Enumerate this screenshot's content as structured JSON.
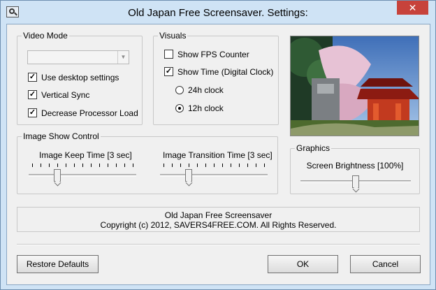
{
  "window": {
    "title": "Old Japan Free Screensaver. Settings:",
    "close_glyph": "✕"
  },
  "video_mode": {
    "legend": "Video Mode",
    "resolution_value": "",
    "options": [
      {
        "label": "Use desktop settings",
        "checked": true
      },
      {
        "label": "Vertical Sync",
        "checked": true
      },
      {
        "label": "Decrease Processor Load",
        "checked": true
      }
    ]
  },
  "visuals": {
    "legend": "Visuals",
    "show_fps": {
      "label": "Show FPS Counter",
      "checked": false
    },
    "show_time": {
      "label": "Show Time (Digital Clock)",
      "checked": true
    },
    "clock_24h": {
      "label": "24h clock",
      "selected": false
    },
    "clock_12h": {
      "label": "12h clock",
      "selected": true
    }
  },
  "image_show": {
    "legend": "Image Show Control",
    "keep_time_label": "Image Keep Time [3 sec]",
    "keep_time_fraction": 0.25,
    "transition_label": "Image Transition Time [3 sec]",
    "transition_fraction": 0.25
  },
  "graphics": {
    "legend": "Graphics",
    "brightness_label": "Screen Brightness [100%]",
    "brightness_fraction": 0.5
  },
  "info": {
    "line1": "Old Japan Free Screensaver",
    "line2": "Copyright (c) 2012, SAVERS4FREE.COM. All Rights Reserved."
  },
  "buttons": {
    "restore": "Restore Defaults",
    "ok": "OK",
    "cancel": "Cancel"
  }
}
